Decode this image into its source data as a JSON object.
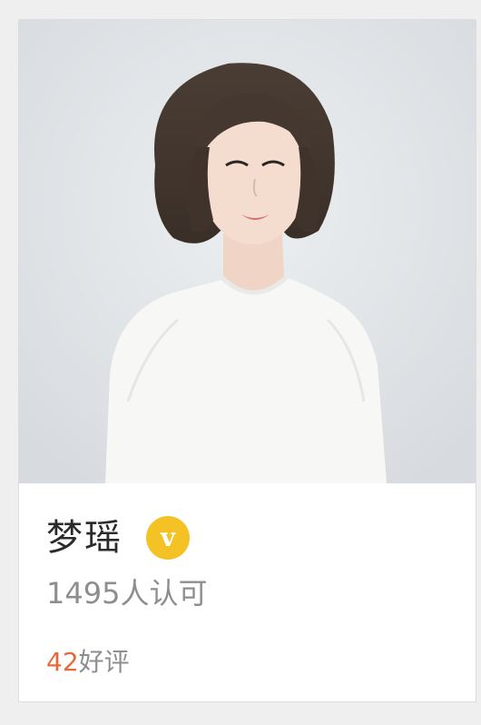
{
  "profile": {
    "name": "梦瑶",
    "verified_badge": "v",
    "approvals": "1495人认可",
    "reviews_count": "42",
    "reviews_label": "好评"
  },
  "icons": {
    "verified": "verified-v-icon"
  },
  "colors": {
    "badge": "#f5c226",
    "review_count": "#e8683a",
    "secondary_text": "#8e8e8e",
    "name_text": "#2b2b2b"
  }
}
